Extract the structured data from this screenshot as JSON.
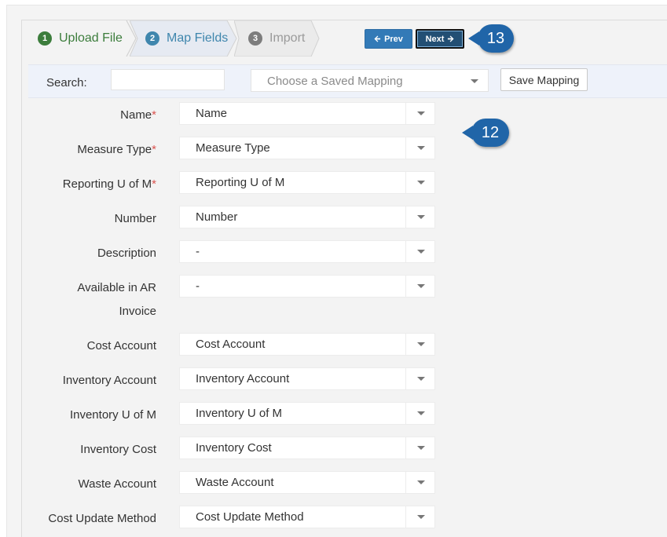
{
  "wizard": {
    "steps": [
      {
        "number": "1",
        "label": "Upload File"
      },
      {
        "number": "2",
        "label": "Map Fields"
      },
      {
        "number": "3",
        "label": "Import"
      }
    ],
    "prev_label": "Prev",
    "next_label": "Next",
    "colors": {
      "done": "#3c7d3c",
      "active": "#3f86ad",
      "pending": "#9a9a9a",
      "primary": "#337ab7"
    }
  },
  "callouts": {
    "next": "13",
    "fields": "12"
  },
  "search": {
    "label": "Search:",
    "value": "",
    "mapping_placeholder": "Choose a Saved Mapping",
    "save_label": "Save Mapping"
  },
  "fields": [
    {
      "label": "Name",
      "required": "*",
      "value": "Name"
    },
    {
      "label": "Measure Type",
      "required": "*",
      "value": "Measure Type"
    },
    {
      "label": "Reporting U of M",
      "required": "*",
      "value": "Reporting U of M"
    },
    {
      "label": "Number",
      "required": "",
      "value": "Number"
    },
    {
      "label": "Description",
      "required": "",
      "value": "-"
    },
    {
      "label": "Available in AR Invoice",
      "required": "",
      "value": "-"
    },
    {
      "label": "Cost Account",
      "required": "",
      "value": "Cost Account"
    },
    {
      "label": "Inventory Account",
      "required": "",
      "value": "Inventory Account"
    },
    {
      "label": "Inventory U of M",
      "required": "",
      "value": "Inventory U of M"
    },
    {
      "label": "Inventory Cost",
      "required": "",
      "value": "Inventory Cost"
    },
    {
      "label": "Waste Account",
      "required": "",
      "value": "Waste Account"
    },
    {
      "label": "Cost Update Method",
      "required": "",
      "value": "Cost Update Method"
    }
  ]
}
